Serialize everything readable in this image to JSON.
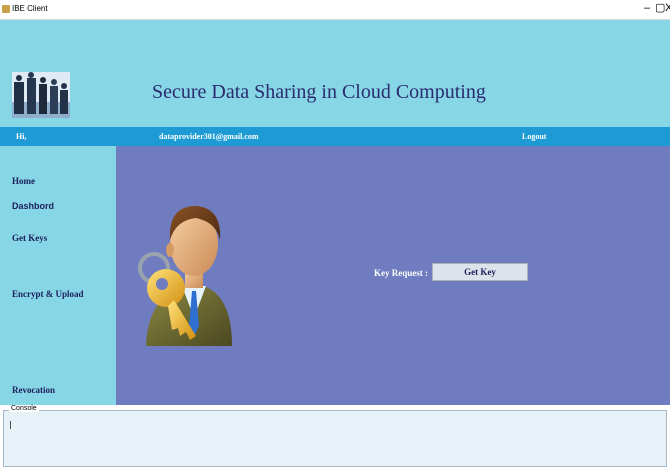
{
  "window": {
    "title": "IBE Client",
    "controls": [
      "–",
      "▢",
      "X"
    ]
  },
  "header": {
    "title": "Secure Data Sharing in Cloud Computing"
  },
  "infobar": {
    "greeting": "Hi,",
    "email": "dataprovider301@gmail.com",
    "logout": "Logout"
  },
  "sidebar": {
    "items": [
      {
        "label": "Home"
      },
      {
        "label": "Dashbord"
      },
      {
        "label": "Get Keys"
      },
      {
        "label": "Encrypt & Upload"
      },
      {
        "label": "Revocation"
      }
    ]
  },
  "main": {
    "key_request_label": "Key Request :",
    "get_key_button": "Get Key"
  },
  "console": {
    "legend": "Console",
    "text": ""
  },
  "colors": {
    "header_bg": "#86d6e6",
    "infobar_bg": "#1e9bd4",
    "main_bg": "#6f7cc0",
    "title_text": "#2b2b6e"
  }
}
